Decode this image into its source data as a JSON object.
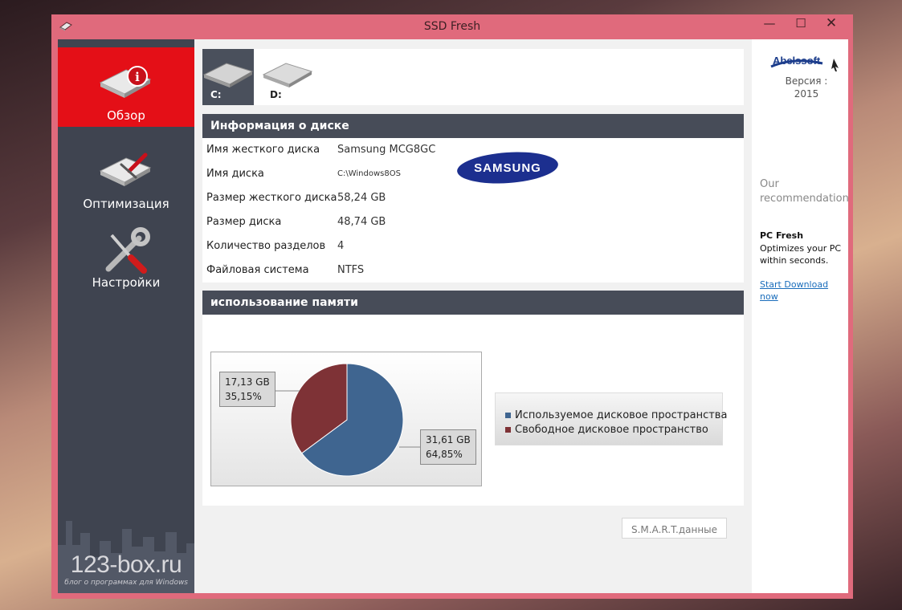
{
  "window": {
    "title": "SSD Fresh",
    "minimize": "—",
    "maximize": "☐",
    "close": "✕"
  },
  "sidebar": {
    "items": [
      {
        "label": "Обзор",
        "active": true
      },
      {
        "label": "Оптимизация",
        "active": false
      },
      {
        "label": "Настройки",
        "active": false
      }
    ],
    "watermark": {
      "main": "123-box.ru",
      "sub": "блог о программах для Windows"
    }
  },
  "drives": [
    {
      "label": "C:",
      "selected": true
    },
    {
      "label": "D:",
      "selected": false
    }
  ],
  "disk_info": {
    "header": "Информация о диске",
    "brand": "SAMSUNG",
    "rows": [
      {
        "key": "Имя жесткого диска",
        "value": "Samsung MCG8GC"
      },
      {
        "key": "Имя диска",
        "value": "C:\\Windows8OS"
      },
      {
        "key": "Размер жесткого диска",
        "value": "58,24 GB"
      },
      {
        "key": "Размер диска",
        "value": "48,74 GB"
      },
      {
        "key": "Количество разделов",
        "value": "4"
      },
      {
        "key": "Файловая система",
        "value": "NTFS"
      }
    ]
  },
  "usage": {
    "header": "использование памяти",
    "free_label": {
      "line1": "17,13 GB",
      "line2": "35,15%"
    },
    "used_label": {
      "line1": "31,61 GB",
      "line2": "64,85%"
    },
    "legend": {
      "used": "Используемое дисковое пространства",
      "free": "Свободное дисковое пространство"
    },
    "smart_button": "S.M.A.R.T.данные"
  },
  "chart_data": {
    "type": "pie",
    "slices": [
      {
        "name": "Используемое дисковое пространства",
        "value": 31.61,
        "percent": 64.85,
        "color": "#3f6590"
      },
      {
        "name": "Свободное дисковое пространство",
        "value": 17.13,
        "percent": 35.15,
        "color": "#7e3236"
      }
    ]
  },
  "right_panel": {
    "logo": "Abelssoft",
    "version_label": "Версия :",
    "version_value": "2015",
    "rec_line1": "Our",
    "rec_line2": "recommendation:",
    "product": "PC Fresh",
    "product_desc": "Optimizes your PC within seconds.",
    "download": "Start Download now"
  },
  "colors": {
    "accent_red": "#e40f17",
    "sidebar": "#3f4450",
    "header": "#474c58",
    "frame": "#e06a7c"
  }
}
